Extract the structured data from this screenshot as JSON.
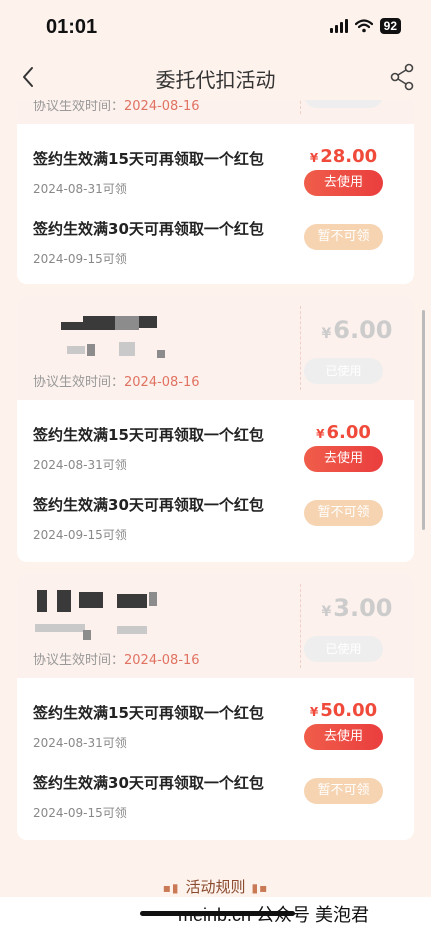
{
  "status": {
    "time": "01:01",
    "battery": "92"
  },
  "nav": {
    "title": "委托代扣活动"
  },
  "partial_card": {
    "agree_label": "协议生效时间：",
    "agree_date": "2024-08-16",
    "rows": [
      {
        "title": "签约生效满15天可再领取一个红包",
        "date": "2024-08-31可领",
        "price": "28.00",
        "button": "去使用"
      },
      {
        "title": "签约生效满30天可再领取一个红包",
        "date": "2024-09-15可领",
        "button": "暂不可领"
      }
    ]
  },
  "cards": [
    {
      "agree_label": "协议生效时间：",
      "agree_date": "2024-08-16",
      "top_price": "6.00",
      "top_button": "已使用",
      "rows": [
        {
          "title": "签约生效满15天可再领取一个红包",
          "date": "2024-08-31可领",
          "price": "6.00",
          "button": "去使用"
        },
        {
          "title": "签约生效满30天可再领取一个红包",
          "date": "2024-09-15可领",
          "button": "暂不可领"
        }
      ]
    },
    {
      "agree_label": "协议生效时间：",
      "agree_date": "2024-08-16",
      "top_price": "3.00",
      "top_button": "已使用",
      "rows": [
        {
          "title": "签约生效满15天可再领取一个红包",
          "date": "2024-08-31可领",
          "price": "50.00",
          "button": "去使用"
        },
        {
          "title": "签约生效满30天可再领取一个红包",
          "date": "2024-09-15可领",
          "button": "暂不可领"
        }
      ]
    }
  ],
  "currency_symbol": "¥",
  "rules_label": "活动规则",
  "watermark": "meinb.cn 公众号 美泡君"
}
